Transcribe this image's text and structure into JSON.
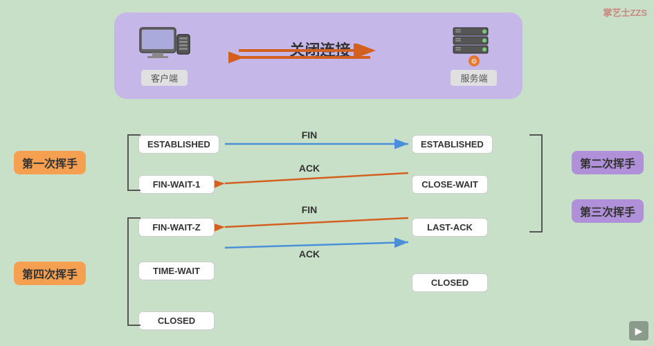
{
  "watermark": {
    "text": "掌艺士ZZS"
  },
  "header": {
    "title": "关闭连接",
    "client_label": "客户端",
    "server_label": "服务端",
    "box_bg": "#c5b8e8"
  },
  "handshakes": {
    "first": "第一次挥手",
    "second": "第二次挥手",
    "third": "第三次挥手",
    "fourth": "第四次挥手"
  },
  "signals": {
    "fin1": "FIN",
    "ack1": "ACK",
    "fin2": "FIN",
    "ack2": "ACK"
  },
  "states": {
    "client": [
      "ESTABLISHED",
      "FIN-WAIT-1",
      "FIN-WAIT-Z",
      "TIME-WAIT",
      "CLOSED"
    ],
    "server": [
      "ESTABLISHED",
      "CLOSE-WAIT",
      "LAST-ACK",
      "CLOSED"
    ]
  },
  "colors": {
    "orange": "#e87830",
    "blue": "#4a90d9",
    "arrow_orange": "#d46020",
    "arrow_blue": "#5080d0",
    "label_orange": "#f5a050",
    "label_purple": "#b090d8",
    "state_bg": "#ffffff",
    "box_bg": "#c5b8e8",
    "bg": "#c8dfc8"
  }
}
